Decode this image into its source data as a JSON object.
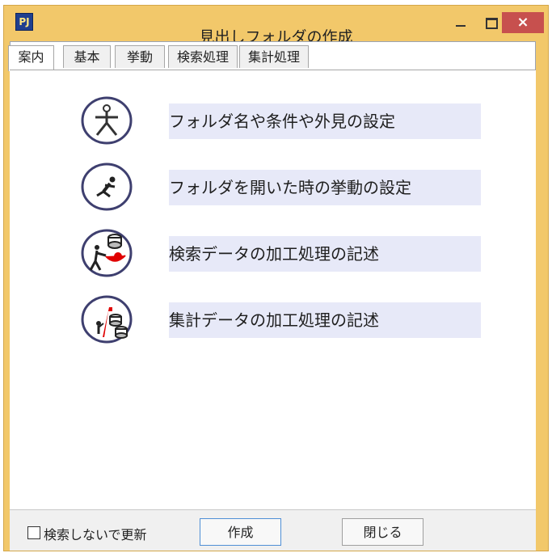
{
  "window": {
    "title": "見出しフォルダの作成",
    "app_icon_text": "PJ",
    "controls": {
      "minimize": "–",
      "maximize": "□",
      "close": "×"
    }
  },
  "tabs": [
    {
      "label": "案内",
      "active": true
    },
    {
      "label": "基本",
      "active": false
    },
    {
      "label": "挙動",
      "active": false
    },
    {
      "label": "検索処理",
      "active": false
    },
    {
      "label": "集計処理",
      "active": false
    }
  ],
  "guide_items": [
    {
      "label": "フォルダ名や条件や外見の設定",
      "icon": "person-icon"
    },
    {
      "label": "フォルダを開いた時の挙動の設定",
      "icon": "running-figure-icon"
    },
    {
      "label": "検索データの加工処理の記述",
      "icon": "data-processing-icon"
    },
    {
      "label": "集計データの加工処理の記述",
      "icon": "aggregation-processing-icon"
    }
  ],
  "footer": {
    "checkbox_label": "検索しないで更新",
    "checkbox_checked": false,
    "create_button": "作成",
    "close_button": "閉じる"
  },
  "colors": {
    "titlebar": "#f2c86a",
    "close_button": "#c7504e",
    "guide_background": "#e7e9f8",
    "icon_stroke": "#3e3f6f",
    "accent_red": "#e00000"
  }
}
